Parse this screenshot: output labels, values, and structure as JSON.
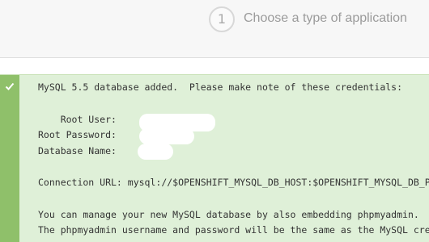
{
  "wizard": {
    "step_number": "1",
    "step_title": "Choose a type of application"
  },
  "message": {
    "headline": "MySQL 5.5 database added.  Please make note of these credentials:",
    "root_user_label": "    Root User:",
    "root_password_label": "Root Password:",
    "database_name_label": "Database Name:",
    "connection_url": "Connection URL: mysql://$OPENSHIFT_MYSQL_DB_HOST:$OPENSHIFT_MYSQL_DB_PORT/",
    "manage_line": "You can manage your new MySQL database by also embedding phpmyadmin.",
    "phpmyadmin_line": "The phpmyadmin username and password will be the same as the MySQL credentials above."
  },
  "icons": {
    "success": "check-icon"
  },
  "colors": {
    "panel_background": "#dff0d8",
    "strip": "#8fc06a",
    "text": "#333333"
  }
}
